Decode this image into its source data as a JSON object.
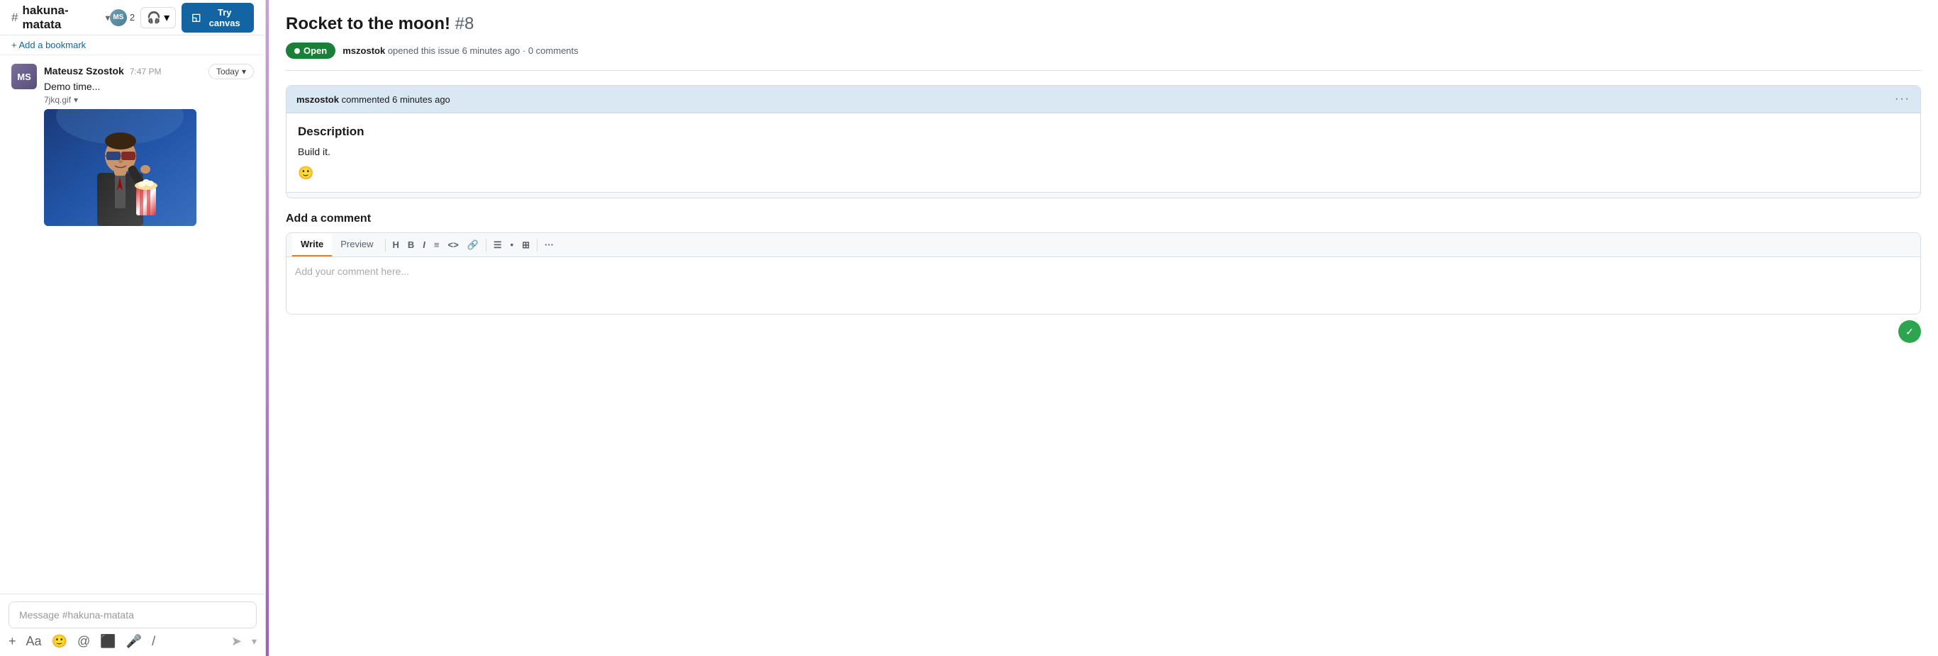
{
  "chat": {
    "channel_name": "hakuna-matata",
    "member_count": "2",
    "headphone_icon": "🎧",
    "try_canvas_label": "Try canvas",
    "canvas_icon": "◱",
    "bookmark_label": "+ Add a bookmark",
    "message": {
      "author": "Mateusz Szostok",
      "time": "7:47 PM",
      "text": "Demo time...",
      "gif_filename": "7jkq.gif",
      "date_label": "Today"
    },
    "input_placeholder": "Message #hakuna-matata",
    "toolbar": {
      "plus": "+",
      "text": "Aa",
      "emoji": "🙂",
      "mention": "@",
      "video": "⬛",
      "mic": "🎤",
      "slash": "/"
    }
  },
  "issue": {
    "title": "Rocket to the moon!",
    "number": "#8",
    "status": "Open",
    "meta_text": "mszostok opened this issue 6 minutes ago · 0 comments",
    "comment": {
      "author": "mszostok",
      "action": "commented 6 minutes ago",
      "section_title": "Description",
      "body_text": "Build it.",
      "emoji_icon": "🙂"
    },
    "add_comment_title": "Add a comment",
    "editor": {
      "write_tab": "Write",
      "preview_tab": "Preview",
      "placeholder": "Add your comment here...",
      "tools": [
        "H",
        "B",
        "I",
        "≡",
        "<>",
        "🔗",
        "☰",
        "•",
        "⊞"
      ]
    }
  }
}
